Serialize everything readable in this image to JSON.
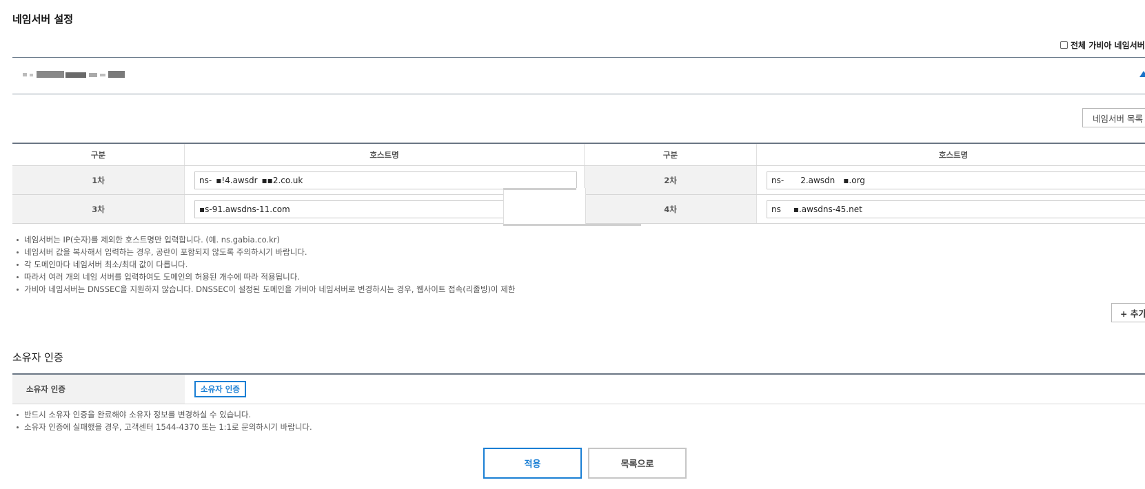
{
  "nameserver_section": {
    "title": "네임서버 설정",
    "all_gabia_checkbox_label": "전체 가비아 네임서버 사",
    "list_button_label": "네임서버 목록",
    "table_headers": {
      "col1": "구분",
      "col2": "호스트명",
      "col3": "구분",
      "col4": "호스트명"
    },
    "rows": [
      {
        "left_label": "1차",
        "left_value": "ns- ▪!4.awsdr ▪▪2.co.uk",
        "right_label": "2차",
        "right_value": "ns-    2.awsdn  ▪.org"
      },
      {
        "left_label": "3차",
        "left_value": "▪s-91.awsdns-11.com",
        "right_label": "4차",
        "right_value": "ns   ▪.awsdns-45.net"
      }
    ],
    "notes": [
      "네임서버는 IP(숫자)를 제외한 호스트명만 입력합니다. (예. ns.gabia.co.kr)",
      "네임서버 값을 복사해서 입력하는 경우, 공란이 포함되지 않도록 주의하시기 바랍니다.",
      "각 도메인마다 네임서버 최소/최대 값이 다릅니다.",
      "따라서 여러 개의 네임 서버를 입력하여도 도메인의 허용된 개수에 따라 적용됩니다.",
      "가비아 네임서버는 DNSSEC을 지원하지 않습니다. DNSSEC이 설정된 도메인을 가비아 네임서버로 변경하시는 경우, 웹사이트 접속(리졸빙)이 제한"
    ],
    "add_button_label": "+ 추가"
  },
  "owner_section": {
    "title": "소유자 인증",
    "row_label": "소유자 인증",
    "verify_button_label": "소유자 인증",
    "notes": [
      "반드시 소유자 인증을 완료해야 소유자 정보를 변경하실 수 있습니다.",
      "소유자 인증에 실패했을 경우, 고객센터 1544-4370 또는 1:1로 문의하시기 바랍니다."
    ]
  },
  "actions": {
    "apply_label": "적용",
    "back_to_list_label": "목록으로"
  },
  "colors": {
    "accent": "#1a7fd4",
    "header_line": "#6a7684",
    "label_bg": "#f2f2f2"
  },
  "icons": {
    "collapse": "triangle-up-icon",
    "checkbox": "checkbox-icon"
  }
}
